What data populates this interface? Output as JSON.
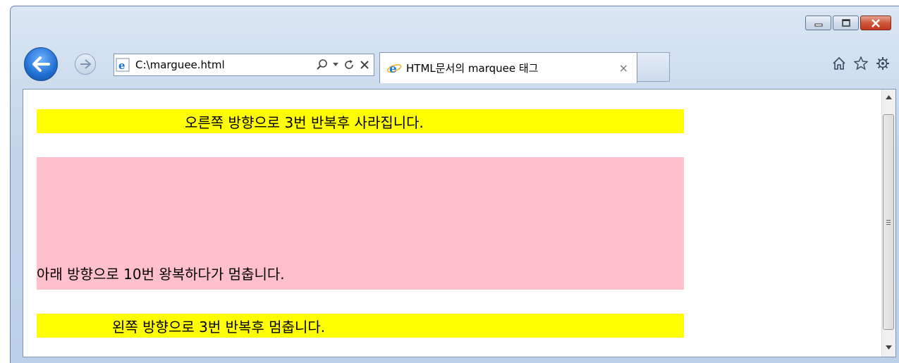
{
  "browser": {
    "address": "C:\\marguee.html",
    "tab_title": "HTML문서의 marquee 태그",
    "tab_close": "×",
    "icons": [
      "back-arrow-icon",
      "forward-arrow-icon",
      "ie-page-icon",
      "search-icon",
      "dropdown-icon",
      "refresh-icon",
      "stop-icon",
      "home-icon",
      "favorites-star-icon",
      "tools-gear-icon"
    ]
  },
  "page": {
    "marquee1": {
      "text": "오른쪽 방향으로 3번 반복후 사라집니다.",
      "background": "#ffff00"
    },
    "marquee2": {
      "text": "아래 방향으로 10번 왕복하다가 멈춥니다.",
      "background": "#ffc0cb"
    },
    "marquee3": {
      "text": "왼쪽 방향으로 3번 반복후 멈춥니다.",
      "background": "#ffff00"
    }
  },
  "colors": {
    "frame": "#c3d5ea",
    "back_button": "#1f6fd2",
    "close_button": "#c2391e"
  }
}
